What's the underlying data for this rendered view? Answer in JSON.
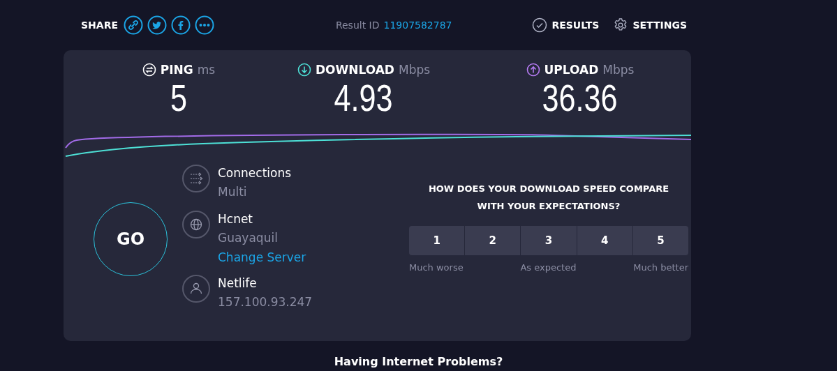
{
  "header": {
    "share_label": "SHARE",
    "share_links": [
      {
        "kind": "link"
      },
      {
        "kind": "twitter"
      },
      {
        "kind": "facebook"
      },
      {
        "kind": "more"
      }
    ],
    "result_id_label": "Result ID",
    "result_id": "11907582787",
    "nav": [
      {
        "kind": "results",
        "label": "RESULTS"
      },
      {
        "kind": "settings",
        "label": "SETTINGS"
      }
    ]
  },
  "metrics": [
    {
      "kind": "ping",
      "label": "PING",
      "unit": "ms",
      "value": "5"
    },
    {
      "kind": "download",
      "label": "DOWNLOAD",
      "unit": "Mbps",
      "value": "4.93"
    },
    {
      "kind": "upload",
      "label": "UPLOAD",
      "unit": "Mbps",
      "value": "36.36"
    }
  ],
  "go_button": "GO",
  "info": [
    {
      "kind": "connections",
      "title": "Connections",
      "lines": [
        {
          "text": "Multi",
          "kind": "detail"
        }
      ]
    },
    {
      "kind": "server",
      "title": "Hcnet",
      "lines": [
        {
          "text": "Guayaquil",
          "kind": "detail"
        },
        {
          "text": "Change Server",
          "kind": "link"
        }
      ]
    },
    {
      "kind": "provider",
      "title": "Netlife",
      "lines": [
        {
          "text": "157.100.93.247",
          "kind": "detail"
        }
      ]
    }
  ],
  "rating": {
    "question": "HOW DOES YOUR DOWNLOAD SPEED COMPARE WITH YOUR EXPECTATIONS?",
    "options": [
      {
        "label": "1",
        "selected": false
      },
      {
        "label": "2",
        "selected": false
      },
      {
        "label": "3",
        "selected": false
      },
      {
        "label": "4",
        "selected": false
      },
      {
        "label": "5",
        "selected": false
      }
    ],
    "scale": [
      "Much worse",
      "As expected",
      "Much better"
    ]
  },
  "footer_heading": "Having Internet Problems?"
}
